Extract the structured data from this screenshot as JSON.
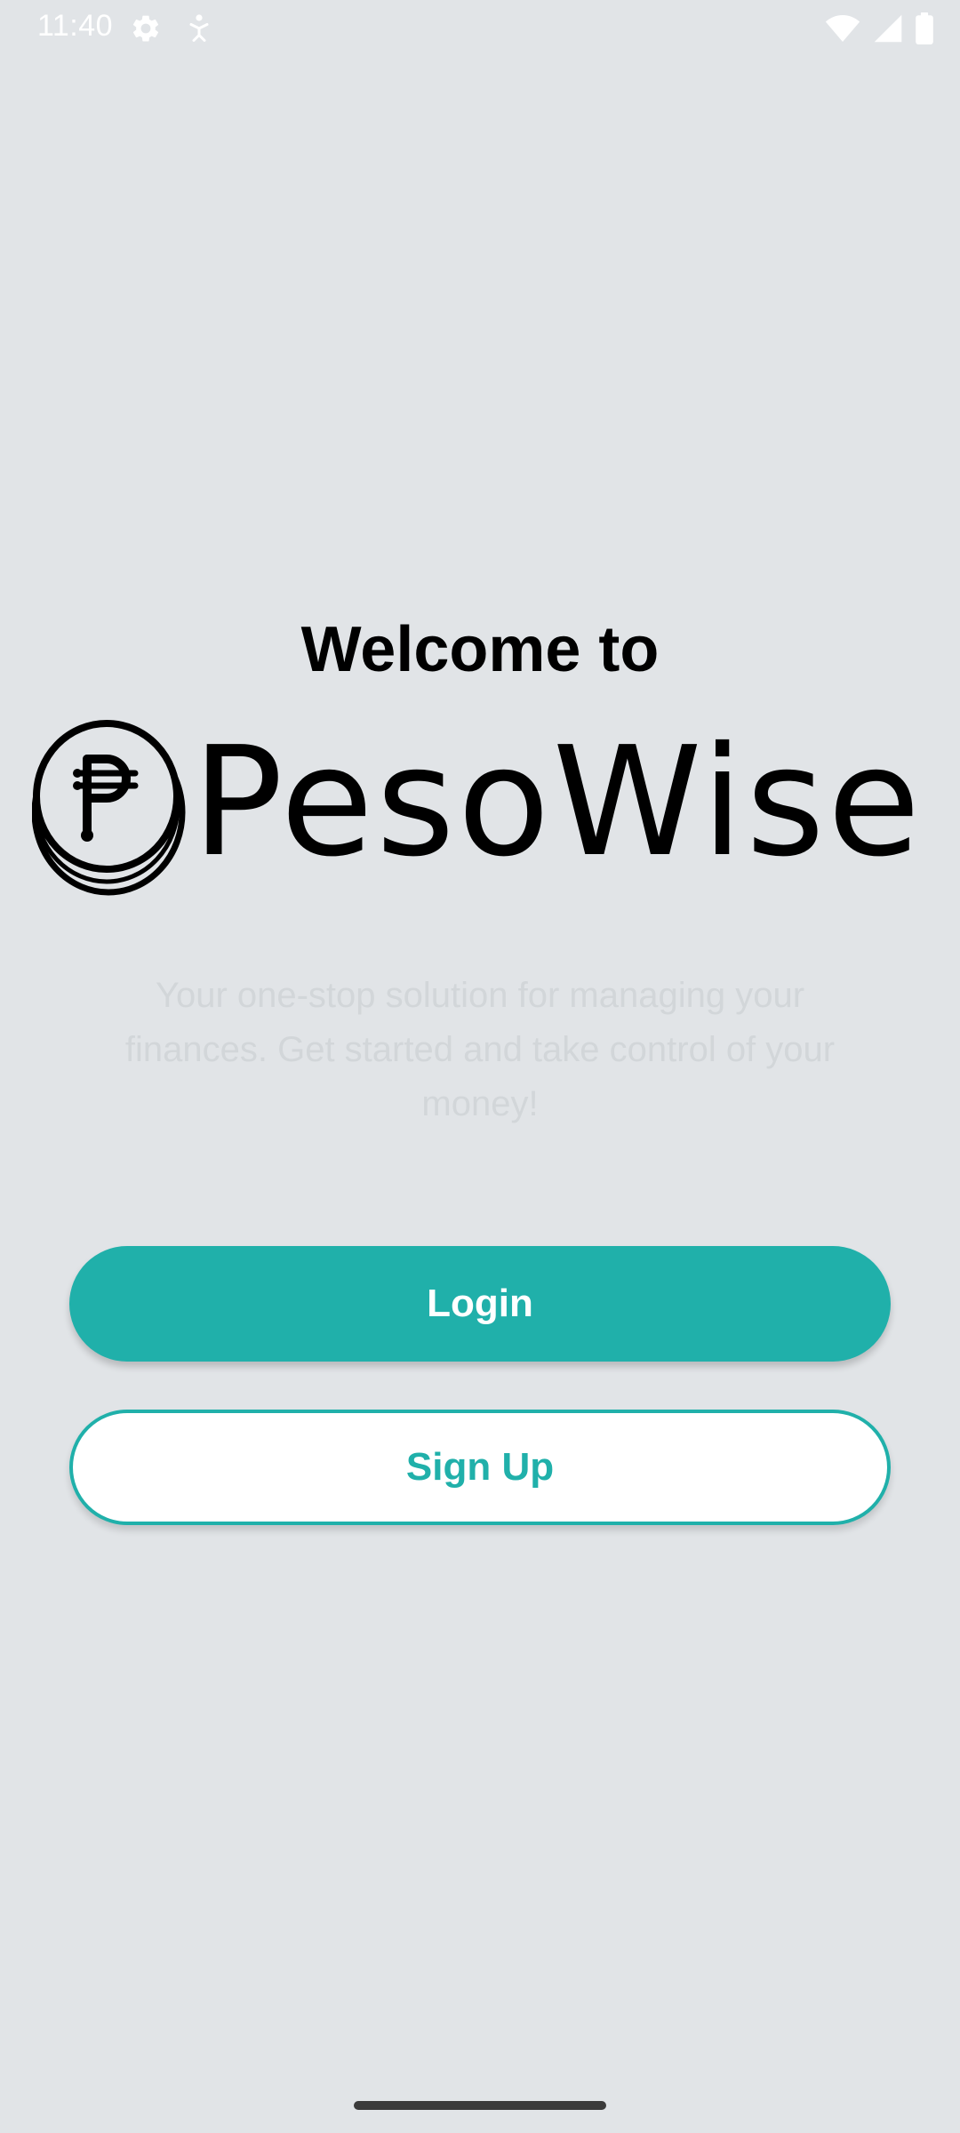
{
  "status_bar": {
    "time": "11:40",
    "left_icons": [
      "settings-icon",
      "accessibility-icon"
    ],
    "right_icons": [
      "wifi-icon",
      "signal-icon",
      "battery-icon"
    ]
  },
  "welcome_title": "Welcome to",
  "logo": {
    "symbol": "₱",
    "wordmark": "PesoWise"
  },
  "tagline": "Your one-stop solution for managing your finances. Get started and take control of your money!",
  "buttons": {
    "login_label": "Login",
    "signup_label": "Sign Up"
  },
  "colors": {
    "background": "#e1e4e7",
    "accent": "#20b0aa",
    "tagline": "#d2d6d9"
  }
}
